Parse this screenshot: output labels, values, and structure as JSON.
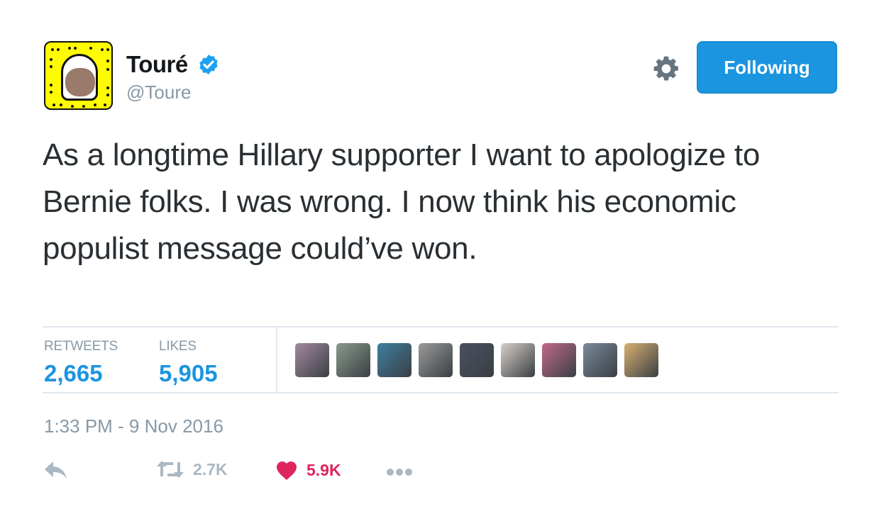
{
  "author": {
    "display_name": "Touré",
    "handle": "@Toure",
    "verified": true,
    "avatar_icon": "snapcode-avatar"
  },
  "header": {
    "settings_icon": "gear-icon",
    "follow_label": "Following"
  },
  "tweet": {
    "text": "As a longtime Hillary supporter I want to apologize to Bernie folks. I was wrong. I now think his economic populist message could’ve won."
  },
  "stats": {
    "retweets_label": "RETWEETS",
    "retweets_value": "2,665",
    "likes_label": "LIKES",
    "likes_value": "5,905"
  },
  "likers": [
    {
      "name": "liker-avatar-1",
      "color": "#a38aa0"
    },
    {
      "name": "liker-avatar-2",
      "color": "#8a9a8c"
    },
    {
      "name": "liker-avatar-3",
      "color": "#3f7fa0"
    },
    {
      "name": "liker-avatar-4",
      "color": "#9a9a9a"
    },
    {
      "name": "liker-avatar-5",
      "color": "#4a5060"
    },
    {
      "name": "liker-avatar-6",
      "color": "#d8cfc8"
    },
    {
      "name": "liker-avatar-7",
      "color": "#c06a8a"
    },
    {
      "name": "liker-avatar-8",
      "color": "#7a8a9a"
    },
    {
      "name": "liker-avatar-9",
      "color": "#d8b070"
    }
  ],
  "timestamp": "1:33 PM - 9 Nov 2016",
  "actions": {
    "reply_icon": "reply-icon",
    "retweet_icon": "retweet-icon",
    "retweet_count": "2.7K",
    "like_icon": "heart-icon",
    "like_count": "5.9K",
    "more_icon": "more-icon"
  },
  "colors": {
    "accent": "#1b95e0",
    "muted": "#8899a6",
    "like": "#e0245e",
    "snap_yellow": "#fffc00"
  }
}
